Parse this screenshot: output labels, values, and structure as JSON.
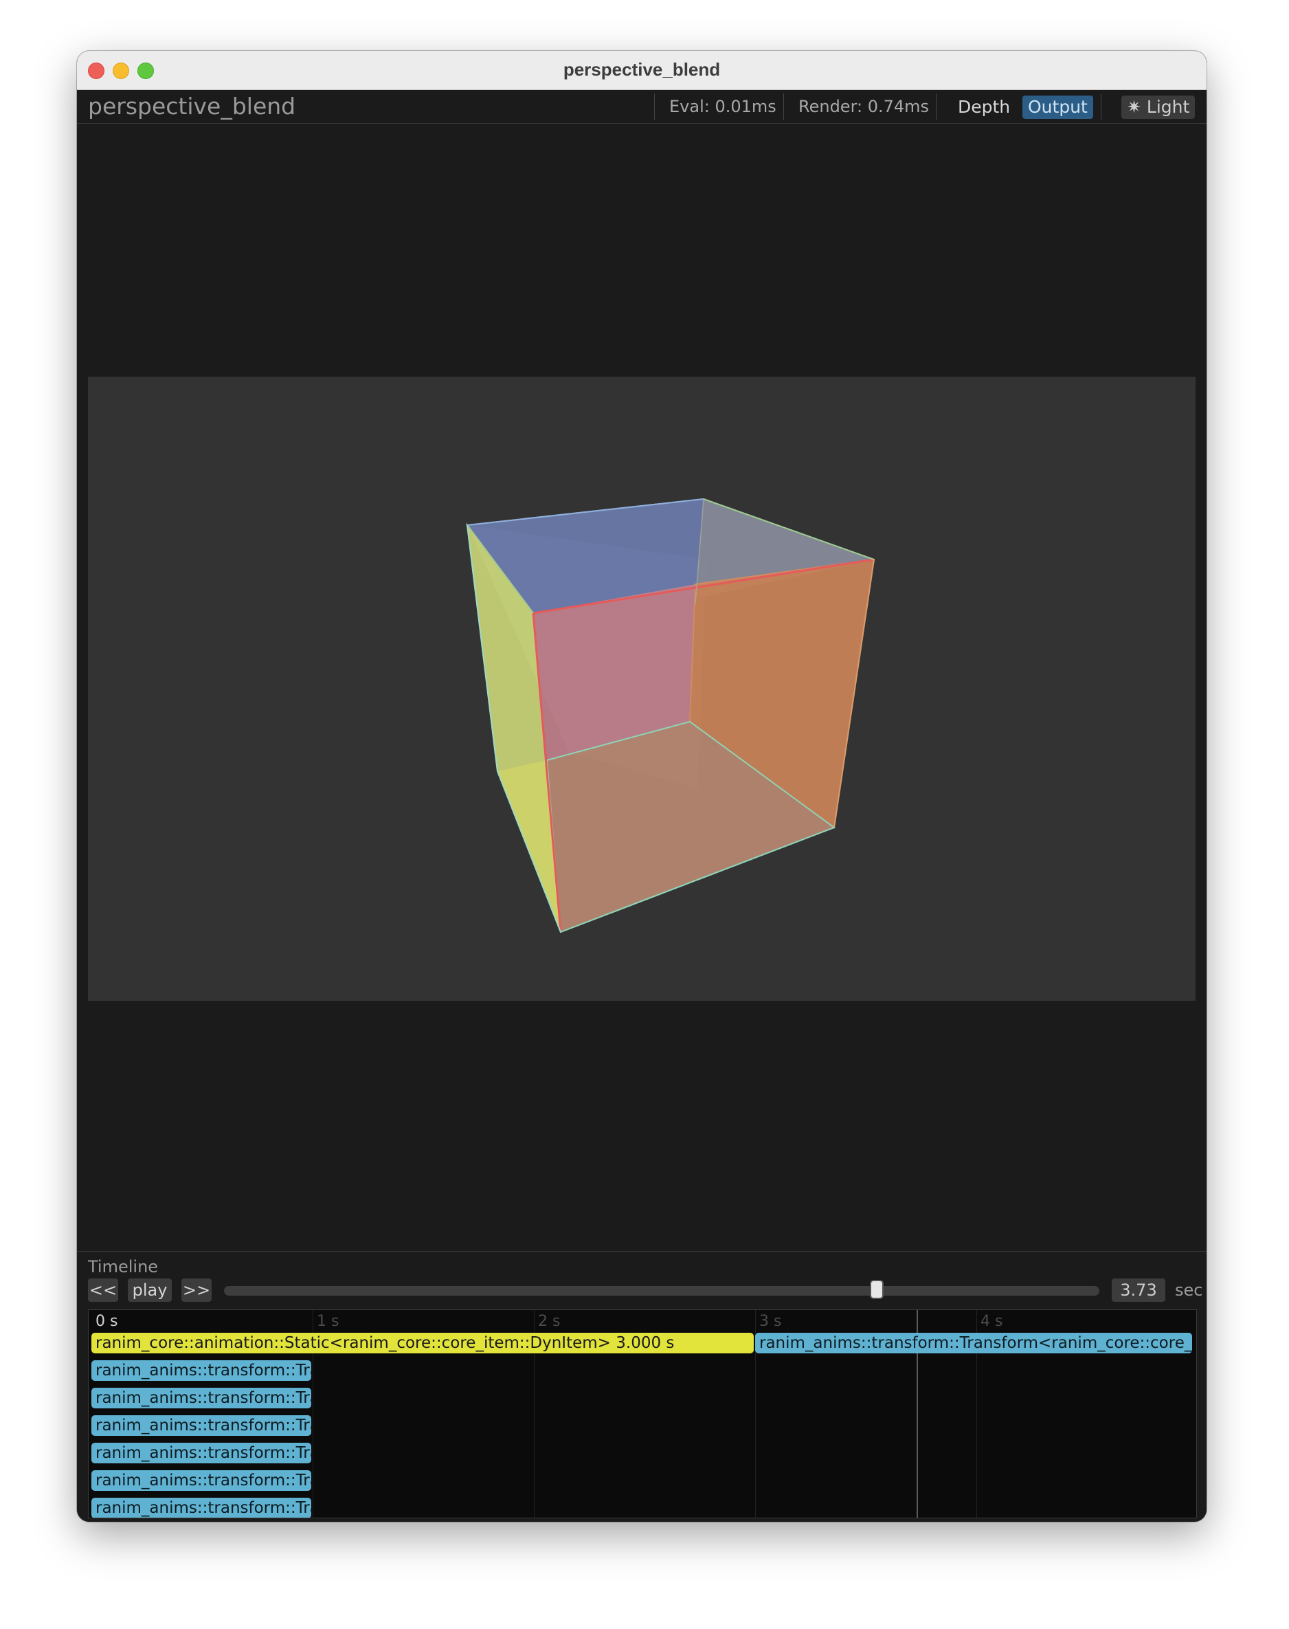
{
  "window": {
    "title": "perspective_blend"
  },
  "toolbar": {
    "app_title": "perspective_blend",
    "eval_label": "Eval: 0.01ms",
    "render_label": "Render: 0.74ms",
    "depth_label": "Depth",
    "output_label": "Output",
    "light_icon": "sun-icon",
    "light_glyph": "✷",
    "light_label": "Light"
  },
  "viewport": {
    "background": "#333333",
    "cube_faces": [
      {
        "name": "top-face",
        "color": "#6d7cae"
      },
      {
        "name": "left-face",
        "color": "#d6e07c"
      },
      {
        "name": "front-face",
        "color": "#d58b8b"
      },
      {
        "name": "right-face",
        "color": "#d8854f"
      }
    ]
  },
  "timeline": {
    "label": "Timeline",
    "rewind_label": "<<",
    "play_label": "play",
    "forward_label": ">>",
    "current_time": "3.73",
    "time_unit": "sec",
    "duration_seconds": 5,
    "playhead_seconds": 3.73,
    "ticks": [
      "0 s",
      "1 s",
      "2 s",
      "3 s",
      "4 s"
    ],
    "clips": [
      {
        "row": 0,
        "start": 0,
        "end": 3.0,
        "kind": "static",
        "label": "ranim_core::animation::Static<ranim_core::core_item::DynItem>  3.000 s"
      },
      {
        "row": 0,
        "start": 3.0,
        "end": 5.0,
        "kind": "transform",
        "label": "ranim_anims::transform::Transform<ranim_core::core_item::DynItem>"
      },
      {
        "row": 1,
        "start": 0,
        "end": 1.0,
        "kind": "transform",
        "label": "ranim_anims::transform::Transform"
      },
      {
        "row": 2,
        "start": 0,
        "end": 1.0,
        "kind": "transform",
        "label": "ranim_anims::transform::Transform"
      },
      {
        "row": 3,
        "start": 0,
        "end": 1.0,
        "kind": "transform",
        "label": "ranim_anims::transform::Transform"
      },
      {
        "row": 4,
        "start": 0,
        "end": 1.0,
        "kind": "transform",
        "label": "ranim_anims::transform::Transform"
      },
      {
        "row": 5,
        "start": 0,
        "end": 1.0,
        "kind": "transform",
        "label": "ranim_anims::transform::Transform"
      },
      {
        "row": 6,
        "start": 0,
        "end": 1.0,
        "kind": "transform",
        "label": "ranim_anims::transform::Transform"
      }
    ]
  }
}
